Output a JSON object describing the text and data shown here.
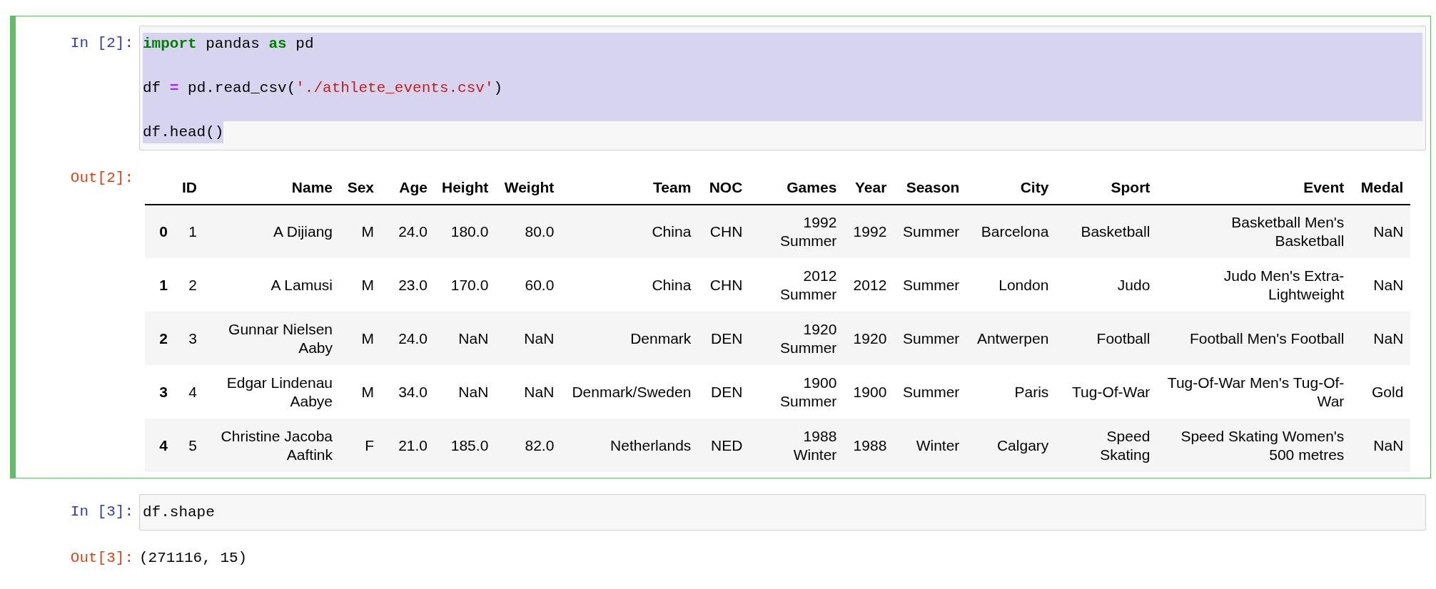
{
  "cells": [
    {
      "selected": true,
      "prompt": "In [2]:",
      "code": {
        "selection": true,
        "lines": [
          [
            {
              "text": "import",
              "kind": "keyword"
            },
            {
              "text": " pandas ",
              "kind": "plain"
            },
            {
              "text": "as",
              "kind": "keyword"
            },
            {
              "text": " pd",
              "kind": "plain"
            }
          ],
          [
            {
              "text": "df ",
              "kind": "plain"
            },
            {
              "text": "=",
              "kind": "operator"
            },
            {
              "text": " pd.read_csv(",
              "kind": "plain"
            },
            {
              "text": "'./athlete_events.csv'",
              "kind": "string"
            },
            {
              "text": ")",
              "kind": "plain"
            }
          ],
          [
            {
              "text": "df.head()",
              "kind": "plain"
            }
          ]
        ]
      },
      "output": {
        "prompt": "Out[2]:",
        "kind": "table",
        "table": {
          "columns": [
            "ID",
            "Name",
            "Sex",
            "Age",
            "Height",
            "Weight",
            "Team",
            "NOC",
            "Games",
            "Year",
            "Season",
            "City",
            "Sport",
            "Event",
            "Medal"
          ],
          "rows": [
            {
              "index": "0",
              "cells": [
                "1",
                "A Dijiang",
                "M",
                "24.0",
                "180.0",
                "80.0",
                "China",
                "CHN",
                "1992 Summer",
                "1992",
                "Summer",
                "Barcelona",
                "Basketball",
                "Basketball Men's Basketball",
                "NaN"
              ]
            },
            {
              "index": "1",
              "cells": [
                "2",
                "A Lamusi",
                "M",
                "23.0",
                "170.0",
                "60.0",
                "China",
                "CHN",
                "2012 Summer",
                "2012",
                "Summer",
                "London",
                "Judo",
                "Judo Men's Extra-Lightweight",
                "NaN"
              ]
            },
            {
              "index": "2",
              "cells": [
                "3",
                "Gunnar Nielsen Aaby",
                "M",
                "24.0",
                "NaN",
                "NaN",
                "Denmark",
                "DEN",
                "1920 Summer",
                "1920",
                "Summer",
                "Antwerpen",
                "Football",
                "Football Men's Football",
                "NaN"
              ]
            },
            {
              "index": "3",
              "cells": [
                "4",
                "Edgar Lindenau Aabye",
                "M",
                "34.0",
                "NaN",
                "NaN",
                "Denmark/Sweden",
                "DEN",
                "1900 Summer",
                "1900",
                "Summer",
                "Paris",
                "Tug-Of-War",
                "Tug-Of-War Men's Tug-Of-War",
                "Gold"
              ]
            },
            {
              "index": "4",
              "cells": [
                "5",
                "Christine Jacoba Aaftink",
                "F",
                "21.0",
                "185.0",
                "82.0",
                "Netherlands",
                "NED",
                "1988 Winter",
                "1988",
                "Winter",
                "Calgary",
                "Speed Skating",
                "Speed Skating Women's 500 metres",
                "NaN"
              ]
            }
          ]
        }
      }
    },
    {
      "selected": false,
      "prompt": "In [3]:",
      "code": {
        "selection": false,
        "lines": [
          [
            {
              "text": "df.shape",
              "kind": "plain"
            }
          ]
        ]
      },
      "output": {
        "prompt": "Out[3]:",
        "kind": "text",
        "text": "(271116, 15)"
      }
    }
  ]
}
